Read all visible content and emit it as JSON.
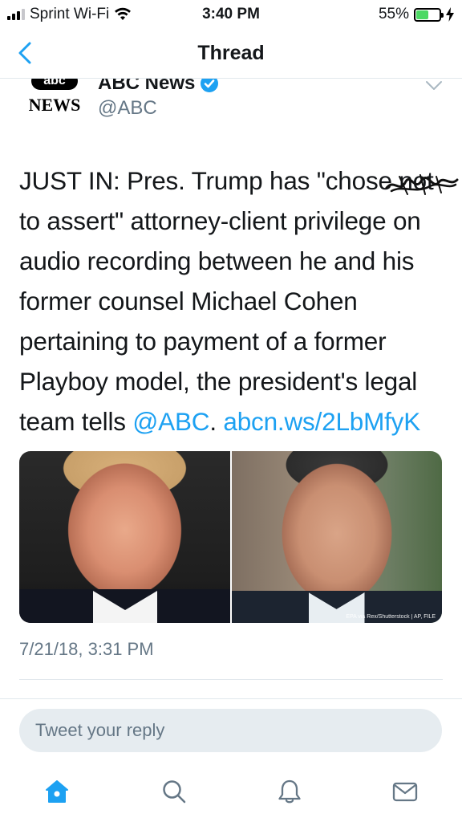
{
  "status_bar": {
    "carrier": "Sprint Wi-Fi",
    "time": "3:40 PM",
    "battery": "55%",
    "battery_level": 0.55,
    "battery_color": "#4cd964"
  },
  "nav": {
    "title": "Thread",
    "back_icon": "chevron-left-icon",
    "accent": "#1da1f2"
  },
  "tweet": {
    "logo_top": "abc",
    "logo_bottom": "NEWS",
    "author_name": "ABC News",
    "handle": "@ABC",
    "verified_icon": "verified-badge-icon",
    "text_before_mention": "JUST IN: Pres. Trump has \"chose not to assert\" attorney-client privilege on audio recording between he and his former counsel Michael Cohen pertaining to payment of a former Playboy model, the president's legal team tells ",
    "mention": "@ABC",
    "text_between": ". ",
    "link": "abcn.ws/2LbMfyK",
    "image_credit": "EPA via Rex/Shutterstock | AP, FILE",
    "timestamp": "7/21/18, 3:31 PM"
  },
  "reply": {
    "placeholder": "Tweet your reply"
  },
  "tabs": [
    {
      "name": "home",
      "icon": "home-icon",
      "active": true
    },
    {
      "name": "search",
      "icon": "search-icon",
      "active": false
    },
    {
      "name": "notifications",
      "icon": "bell-icon",
      "active": false
    },
    {
      "name": "messages",
      "icon": "mail-icon",
      "active": false
    }
  ]
}
